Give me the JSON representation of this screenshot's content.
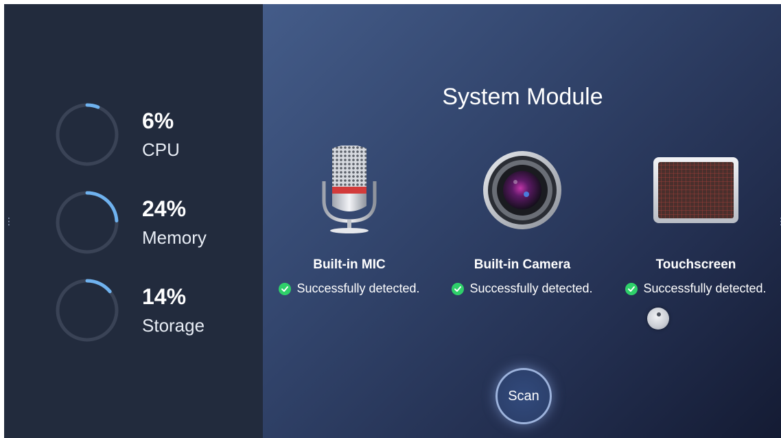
{
  "stats": [
    {
      "value": "6%",
      "label": "CPU",
      "percent": 6
    },
    {
      "value": "24%",
      "label": "Memory",
      "percent": 24
    },
    {
      "value": "14%",
      "label": "Storage",
      "percent": 14
    }
  ],
  "main": {
    "title": "System Module",
    "modules": [
      {
        "name": "Built-in MIC",
        "status": "Successfully detected.",
        "icon": "microphone-icon"
      },
      {
        "name": "Built-in Camera",
        "status": "Successfully detected.",
        "icon": "camera-icon"
      },
      {
        "name": "Touchscreen",
        "status": "Successfully detected.",
        "icon": "touchscreen-icon"
      }
    ],
    "scan_label": "Scan"
  },
  "colors": {
    "left_bg": "#222b3d",
    "gauge_track": "#3a4356",
    "gauge_fill": "#6fb2ef",
    "success": "#2fd06a"
  }
}
